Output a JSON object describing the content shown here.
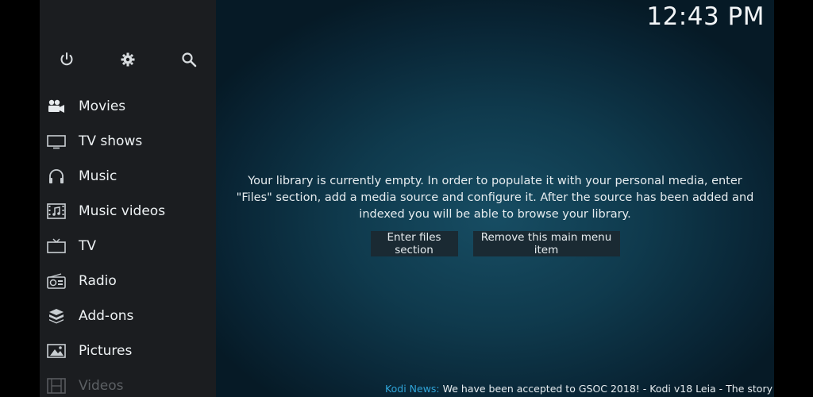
{
  "clock": "12:43 PM",
  "top_icons": [
    {
      "name": "power-icon"
    },
    {
      "name": "gear-icon"
    },
    {
      "name": "search-icon"
    }
  ],
  "menu": [
    {
      "label": "Movies",
      "icon": "movie-camera-icon"
    },
    {
      "label": "TV shows",
      "icon": "monitor-icon"
    },
    {
      "label": "Music",
      "icon": "headphones-icon"
    },
    {
      "label": "Music videos",
      "icon": "film-music-icon"
    },
    {
      "label": "TV",
      "icon": "tv-icon"
    },
    {
      "label": "Radio",
      "icon": "radio-icon"
    },
    {
      "label": "Add-ons",
      "icon": "addons-box-icon"
    },
    {
      "label": "Pictures",
      "icon": "picture-icon"
    },
    {
      "label": "Videos",
      "icon": "film-strip-icon"
    }
  ],
  "message": "Your library is currently empty. In order to populate it with your personal media, enter \"Files\" section, add a media source and configure it. After the source has been added and indexed you will be able to browse your library.",
  "buttons": {
    "enter_files": "Enter files section",
    "remove_item": "Remove this main menu item"
  },
  "ticker": {
    "source": "Kodi News:",
    "text": "We have been accepted to GSOC 2018! - Kodi v18 Leia - The story"
  },
  "colors": {
    "sidebar": "#1b1d20",
    "accent": "#2fa4d8",
    "button_bg": "#1a2a33"
  }
}
